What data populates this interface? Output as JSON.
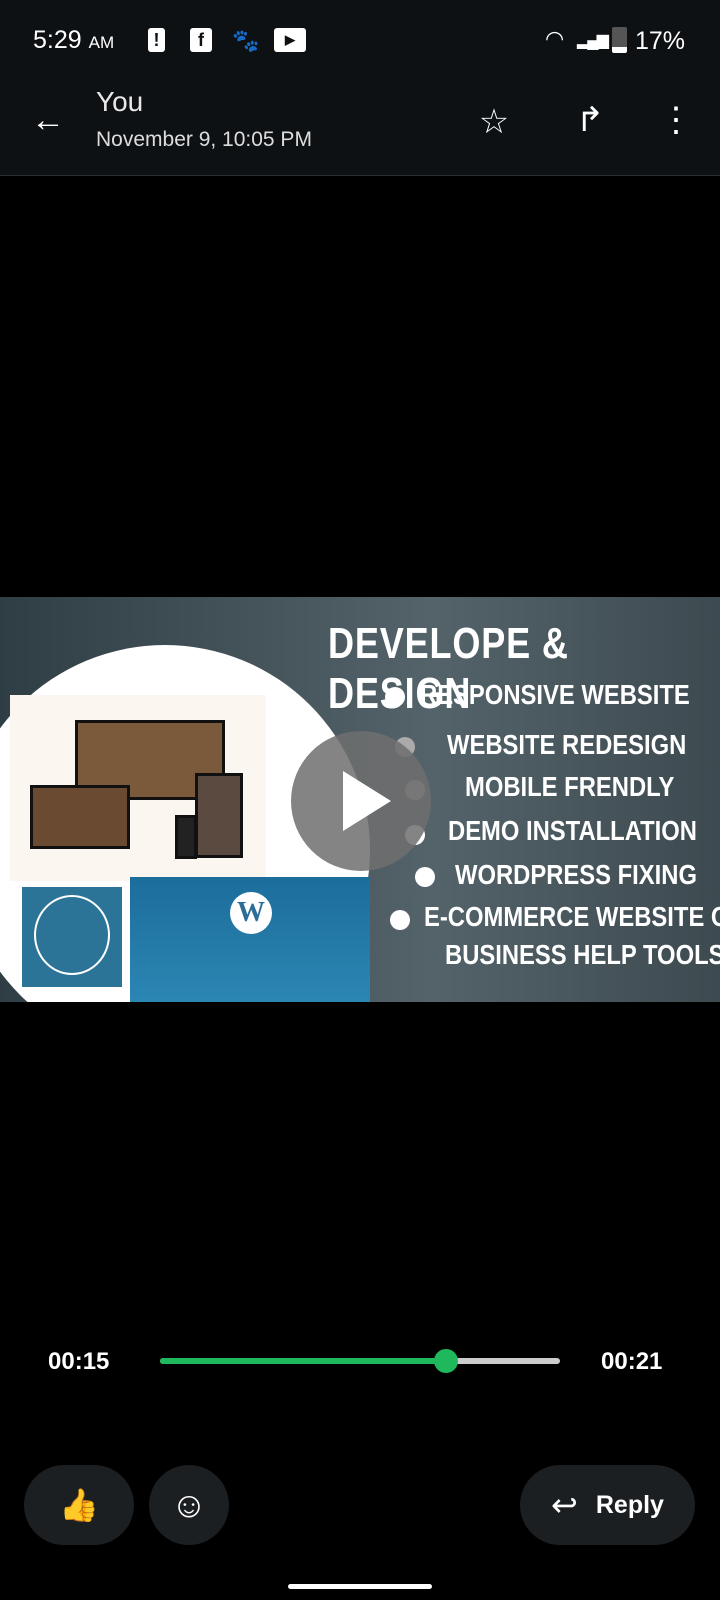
{
  "status_bar": {
    "time": "5:29",
    "ampm": "AM",
    "notification_icons": [
      "alert-icon",
      "facebook-icon",
      "cat-icon",
      "youtube-icon"
    ],
    "battery": "17%"
  },
  "header": {
    "title": "You",
    "subtitle": "November 9, 10:05 PM"
  },
  "video": {
    "heading": "DEVELOPE & DESIGN",
    "bullets": [
      "RESPONSIVE WEBSITE",
      "WEBSITE REDESIGN",
      "MOBILE FRENDLY",
      "DEMO INSTALLATION",
      "WORDPRESS FIXING",
      "E-COMMERCE WEBSITE ON",
      "BUSINESS HELP TOOLS"
    ],
    "logo": "W"
  },
  "player": {
    "elapsed": "00:15",
    "duration": "00:21",
    "progress": 0.714,
    "accent": "#1fb85c"
  },
  "actions": {
    "like_emoji": "👍",
    "reply": "Reply"
  }
}
